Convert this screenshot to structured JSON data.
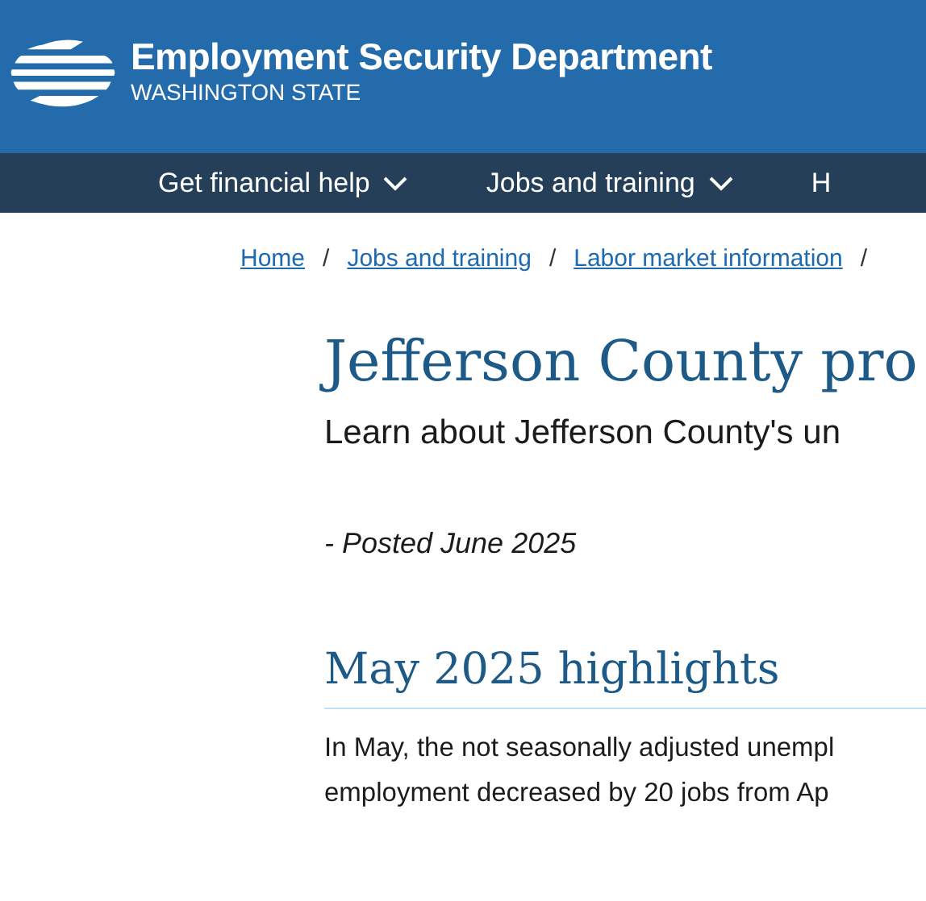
{
  "header": {
    "title": "Employment Security Department",
    "subtitle": "WASHINGTON STATE"
  },
  "nav": [
    {
      "label": "Get financial help",
      "kind": "dropdown"
    },
    {
      "label": "Jobs and training",
      "kind": "dropdown"
    },
    {
      "label": "H",
      "kind": "plain"
    }
  ],
  "breadcrumb": [
    "Home",
    "Jobs and training",
    "Labor market information"
  ],
  "breadcrumb_separator": "/",
  "title": "Jefferson County pro",
  "lede": "Learn about Jefferson County's un",
  "posted": "- Posted June 2025",
  "section": {
    "heading": "May 2025 highlights",
    "lines": [
      "In May, the not seasonally adjusted unempl",
      "employment decreased by 20 jobs from Ap"
    ]
  }
}
